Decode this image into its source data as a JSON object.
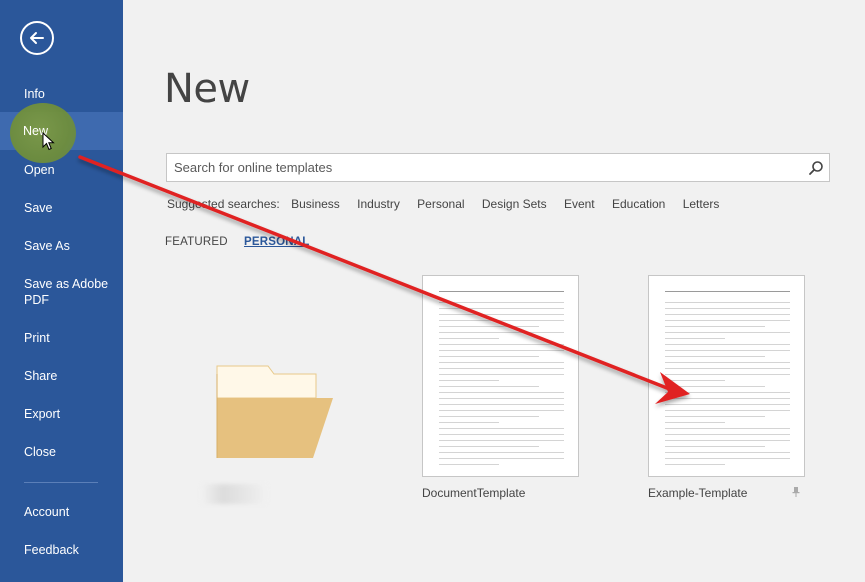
{
  "sidebar": {
    "back_icon": "back-arrow-icon",
    "items": [
      {
        "label": "Info"
      },
      {
        "label": "New"
      },
      {
        "label": "Open"
      },
      {
        "label": "Save"
      },
      {
        "label": "Save As"
      },
      {
        "label": "Save as Adobe PDF"
      },
      {
        "label": "Print"
      },
      {
        "label": "Share"
      },
      {
        "label": "Export"
      },
      {
        "label": "Close"
      },
      {
        "label": "Account"
      },
      {
        "label": "Feedback"
      }
    ],
    "bg_color": "#2b579a"
  },
  "main": {
    "title": "New",
    "search": {
      "placeholder": "Search for online templates",
      "icon": "search-icon"
    },
    "suggested": {
      "label": "Suggested searches:",
      "links": [
        "Business",
        "Industry",
        "Personal",
        "Design Sets",
        "Event",
        "Education",
        "Letters"
      ]
    },
    "tabs": [
      {
        "label": "FEATURED",
        "active": false
      },
      {
        "label": "PERSONAL",
        "active": true
      }
    ],
    "templates": [
      {
        "name": "DocumentTemplate"
      },
      {
        "name": "Example-Template"
      }
    ],
    "folder_icon": "folder-icon",
    "pin_icon": "pin-icon"
  },
  "annotation": {
    "arrow_color": "#e02020",
    "highlight_color": "#6f8e3b"
  }
}
